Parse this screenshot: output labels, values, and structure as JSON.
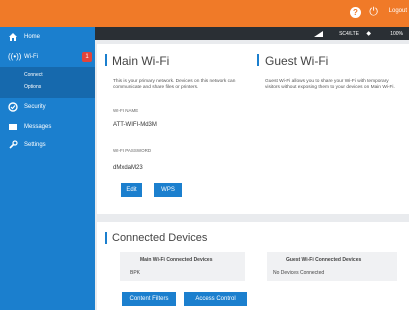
{
  "header": {
    "help_icon": "help-icon",
    "power_icon": "power-icon",
    "logout_label": "Logout"
  },
  "status": {
    "carrier": "SC4/LTE",
    "battery": "100%"
  },
  "sidebar": {
    "items": [
      {
        "label": "Home",
        "icon": "home-icon"
      },
      {
        "label": "Wi-Fi",
        "icon": "wifi-icon",
        "count": "1"
      },
      {
        "label": "Security",
        "icon": "shield-icon"
      },
      {
        "label": "Messages",
        "icon": "envelope-icon"
      },
      {
        "label": "Settings",
        "icon": "wrench-icon"
      }
    ],
    "subitems": [
      {
        "label": "Connect"
      },
      {
        "label": "Options"
      }
    ]
  },
  "main_wifi": {
    "title": "Main Wi-Fi",
    "description": "This is your primary network. Devices on this network can communicate and share files or printers.",
    "name_label": "WI-FI NAME",
    "name_value": "ATT-WIFI-Md3M",
    "password_label": "WI-FI PASSWORD",
    "password_value": "dMxdaM23",
    "edit_label": "Edit",
    "wps_label": "WPS"
  },
  "guest_wifi": {
    "title": "Guest Wi-Fi",
    "description": "Guest Wi-Fi allows you to share your Wi-Fi with temporary visitors without exposing them to your devices on Main Wi-Fi."
  },
  "connected": {
    "title": "Connected Devices",
    "main_header": "Main Wi-Fi Connected Devices",
    "main_rows": [
      "BPK"
    ],
    "guest_header": "Guest Wi-Fi Connected Devices",
    "guest_rows": [
      "No Devices Connected"
    ],
    "content_filters_label": "Content Filters",
    "access_control_label": "Access Control"
  },
  "colors": {
    "accent": "#1b7fce",
    "brand": "#f07a28",
    "sidebar": "#1b7fce",
    "badge": "#e2443b"
  }
}
